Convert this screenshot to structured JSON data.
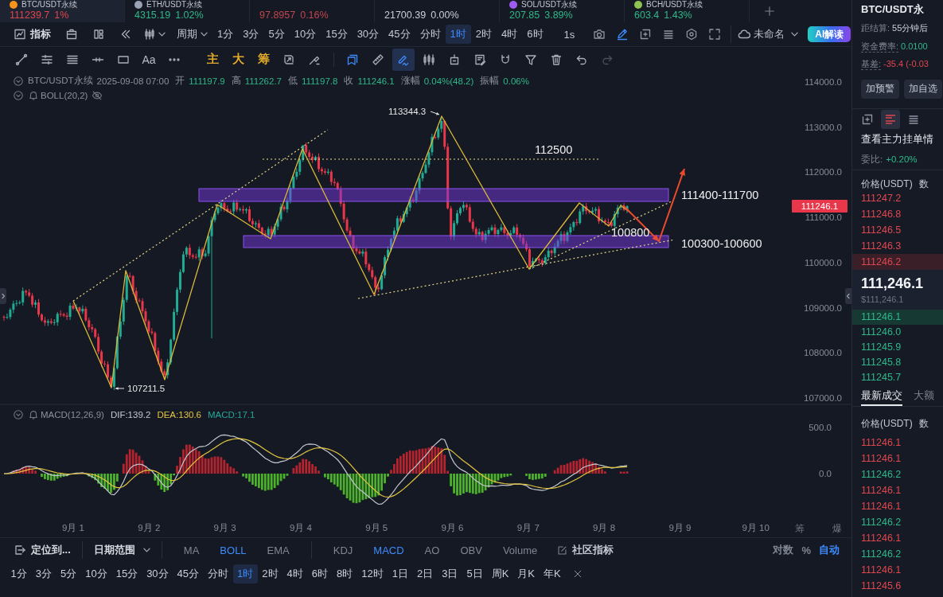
{
  "ticker_tabs": [
    {
      "name": "BTC/USDT永续",
      "price": "111239.7",
      "change": "1%",
      "color": "#e0464e",
      "selected": true
    },
    {
      "name": "ETH/USDT永续",
      "price": "4315.19",
      "change": "1.02%",
      "color": "#2eb889",
      "selected": false
    },
    {
      "price": "97.8957",
      "change": "0.16%",
      "color": "#c2454d",
      "selected": false
    },
    {
      "price": "21700.39",
      "change": "0.00%",
      "color": "#c9ced8",
      "selected": false
    },
    {
      "name": "SOL/USDT永续",
      "price": "207.85",
      "change": "3.89%",
      "color": "#2eb889",
      "selected": false
    },
    {
      "name": "BCH/USDT永续",
      "price": "603.4",
      "change": "1.43%",
      "color": "#2eb889",
      "selected": false
    }
  ],
  "toolbar": {
    "indicators": "指标",
    "period": "周期",
    "intervals": [
      {
        "label": "1分",
        "selected": false
      },
      {
        "label": "3分",
        "selected": false
      },
      {
        "label": "5分",
        "selected": false
      },
      {
        "label": "10分",
        "selected": false
      },
      {
        "label": "15分",
        "selected": false
      },
      {
        "label": "30分",
        "selected": false
      },
      {
        "label": "45分",
        "selected": false
      },
      {
        "label": "分时",
        "selected": false
      },
      {
        "label": "1时",
        "selected": true
      },
      {
        "label": "2时",
        "selected": false
      },
      {
        "label": "4时",
        "selected": false
      },
      {
        "label": "6时",
        "selected": false
      }
    ],
    "seconds": "1s",
    "tools": [
      {
        "active": false
      },
      {
        "active": true
      },
      {
        "active": false
      },
      {
        "active": false
      },
      {
        "active": false
      },
      {
        "active": false
      }
    ],
    "layout": "未命名",
    "ai_button": "AI解读"
  },
  "drawing_tools": [
    {
      "kind": "icon",
      "selected": false,
      "active": false,
      "disabled": false
    },
    {
      "kind": "icon",
      "selected": false,
      "active": false,
      "disabled": false
    },
    {
      "kind": "icon",
      "selected": false,
      "active": false,
      "disabled": false
    },
    {
      "kind": "icon",
      "selected": false,
      "active": false,
      "disabled": false
    },
    {
      "kind": "icon",
      "selected": false,
      "active": false,
      "disabled": false
    },
    {
      "kind": "text",
      "label": "Aa",
      "selected": false,
      "active": false,
      "disabled": false
    },
    {
      "kind": "icon",
      "selected": false,
      "active": false,
      "disabled": false
    },
    {
      "kind": "accent",
      "label": "主",
      "selected": false,
      "active": false,
      "disabled": false
    },
    {
      "kind": "accent",
      "label": "大",
      "selected": false,
      "active": false,
      "disabled": false
    },
    {
      "kind": "accent",
      "label": "筹",
      "selected": false,
      "active": false,
      "disabled": false
    },
    {
      "kind": "icon",
      "selected": false,
      "active": false,
      "disabled": false
    },
    {
      "kind": "icon",
      "selected": false,
      "active": false,
      "disabled": false
    },
    {
      "kind": "icon",
      "selected": false,
      "active": true,
      "disabled": false
    },
    {
      "kind": "icon",
      "selected": false,
      "active": false,
      "disabled": false
    },
    {
      "kind": "icon",
      "selected": true,
      "active": true,
      "disabled": false
    },
    {
      "kind": "icon",
      "selected": false,
      "active": false,
      "disabled": false
    },
    {
      "kind": "icon",
      "selected": false,
      "active": false,
      "disabled": false
    },
    {
      "kind": "icon",
      "selected": false,
      "active": false,
      "disabled": false
    },
    {
      "kind": "icon",
      "selected": false,
      "active": false,
      "disabled": false
    },
    {
      "kind": "icon",
      "selected": false,
      "active": false,
      "disabled": false
    },
    {
      "kind": "icon",
      "selected": false,
      "active": false,
      "disabled": false
    },
    {
      "kind": "icon",
      "selected": false,
      "active": false,
      "disabled": false
    },
    {
      "kind": "icon",
      "selected": false,
      "active": false,
      "disabled": true
    }
  ],
  "chart": {
    "legend": {
      "symbol": "BTC/USDT永续",
      "time": "2025-09-08 07:00",
      "rising": true,
      "fields": [
        {
          "label": "开",
          "value": "111197.9"
        },
        {
          "label": "高",
          "value": "111262.7"
        },
        {
          "label": "低",
          "value": "111197.8"
        },
        {
          "label": "收",
          "value": "111246.1"
        },
        {
          "label": "涨幅",
          "value": "0.04%(48.2)"
        },
        {
          "label": "振幅",
          "value": "0.06%"
        }
      ]
    },
    "boll": {
      "label": "BOLL(20,2)",
      "visible": false
    },
    "price_axis": [
      "114000.0",
      "113000.0",
      "112000.0",
      "111000.0",
      "110000.0",
      "109000.0",
      "108000.0",
      "107000.0"
    ],
    "last_price": "111246.1",
    "annotations": [
      {
        "kind": "high",
        "text": "113344.3"
      },
      {
        "kind": "level",
        "text": "112500"
      },
      {
        "kind": "zone",
        "text": "111400-111700"
      },
      {
        "kind": "level",
        "text": "100800"
      },
      {
        "kind": "zone",
        "text": "100300-100600"
      },
      {
        "kind": "low",
        "text": "107211.5"
      }
    ]
  },
  "macd": {
    "label": "MACD(12,26,9)",
    "values": [
      {
        "text": "DIF:139.2",
        "color": "#c4c8d0"
      },
      {
        "text": "DEA:130.6",
        "color": "#e3c63f"
      },
      {
        "text": "MACD:17.1",
        "color": "#26a69a"
      }
    ],
    "axis": [
      "500.0",
      "0.0"
    ]
  },
  "time_axis": [
    "9月 1",
    "9月 2",
    "9月 3",
    "9月 4",
    "9月 5",
    "9月 6",
    "9月 7",
    "9月 8",
    "9月 9",
    "9月 10"
  ],
  "side_tabs": [
    "筹",
    "爆"
  ],
  "bottom_bar": {
    "locate": "定位到...",
    "date_range": "日期范围",
    "indicators": [
      {
        "label": "MA",
        "selected": false
      },
      {
        "label": "BOLL",
        "selected": true
      },
      {
        "label": "EMA",
        "selected": false
      },
      {
        "label": "KDJ",
        "selected": false
      },
      {
        "label": "MACD",
        "selected": true
      },
      {
        "label": "AO",
        "selected": false
      },
      {
        "label": "OBV",
        "selected": false
      },
      {
        "label": "Volume",
        "selected": false
      }
    ],
    "community": "社区指标",
    "scale_options": [
      {
        "label": "对数",
        "selected": false
      },
      {
        "label": "%",
        "selected": false
      },
      {
        "label": "自动",
        "selected": true
      }
    ]
  },
  "interval_bar": [
    {
      "label": "1分",
      "selected": false
    },
    {
      "label": "3分",
      "selected": false
    },
    {
      "label": "5分",
      "selected": false
    },
    {
      "label": "10分",
      "selected": false
    },
    {
      "label": "15分",
      "selected": false
    },
    {
      "label": "30分",
      "selected": false
    },
    {
      "label": "45分",
      "selected": false
    },
    {
      "label": "分时",
      "selected": false
    },
    {
      "label": "1时",
      "selected": true
    },
    {
      "label": "2时",
      "selected": false
    },
    {
      "label": "4时",
      "selected": false
    },
    {
      "label": "6时",
      "selected": false
    },
    {
      "label": "8时",
      "selected": false
    },
    {
      "label": "12时",
      "selected": false
    },
    {
      "label": "1日",
      "selected": false
    },
    {
      "label": "2日",
      "selected": false
    },
    {
      "label": "3日",
      "selected": false
    },
    {
      "label": "5日",
      "selected": false
    },
    {
      "label": "周K",
      "selected": false
    },
    {
      "label": "月K",
      "selected": false
    },
    {
      "label": "年K",
      "selected": false
    }
  ],
  "side_panel": {
    "title": "BTC/USDT永",
    "stats": [
      {
        "label": "距结算:",
        "value": "55分钟后",
        "color": "#c9ced8",
        "hint": false
      },
      {
        "label": "资金费率:",
        "value": "0.0100",
        "color": "#2eb889",
        "hint": true
      },
      {
        "label": "基差:",
        "value": "-35.4 (-0.03",
        "color": "#e0464e",
        "hint": true
      }
    ],
    "buttons": [
      "加预警",
      "加自选"
    ],
    "view_tabs": [
      {
        "selected": false
      },
      {
        "selected": true
      },
      {
        "selected": false
      }
    ],
    "depth_link": "查看主力挂单情",
    "ratio": {
      "label": "委比:",
      "value": "+0.20%",
      "rising": true
    },
    "book_header": [
      "价格(USDT)",
      "数"
    ],
    "asks": [
      {
        "price": "111247.2",
        "highlighted": false
      },
      {
        "price": "111246.8",
        "highlighted": false
      },
      {
        "price": "111246.5",
        "highlighted": false
      },
      {
        "price": "111246.3",
        "highlighted": false
      },
      {
        "price": "111246.2",
        "highlighted": true
      }
    ],
    "mid_price": "111,246.1",
    "mid_fiat": "$111,246.1",
    "bids": [
      {
        "price": "111246.1",
        "highlighted": true
      },
      {
        "price": "111246.0",
        "highlighted": false
      },
      {
        "price": "111245.9",
        "highlighted": false
      },
      {
        "price": "111245.8",
        "highlighted": false
      },
      {
        "price": "111245.7",
        "highlighted": false
      }
    ],
    "trade_tabs": [
      {
        "label": "最新成交",
        "selected": true
      },
      {
        "label": "大额",
        "selected": false
      }
    ],
    "trades_header": [
      "价格(USDT)",
      "数"
    ],
    "trades": [
      {
        "price": "111246.1",
        "color": "#e0464e"
      },
      {
        "price": "111246.1",
        "color": "#e0464e"
      },
      {
        "price": "111246.2",
        "color": "#2eb889"
      },
      {
        "price": "111246.1",
        "color": "#e0464e"
      },
      {
        "price": "111246.1",
        "color": "#e0464e"
      },
      {
        "price": "111246.2",
        "color": "#2eb889"
      },
      {
        "price": "111246.1",
        "color": "#e0464e"
      },
      {
        "price": "111246.2",
        "color": "#2eb889"
      },
      {
        "price": "111246.1",
        "color": "#e0464e"
      },
      {
        "price": "111245.6",
        "color": "#e0464e"
      }
    ]
  }
}
